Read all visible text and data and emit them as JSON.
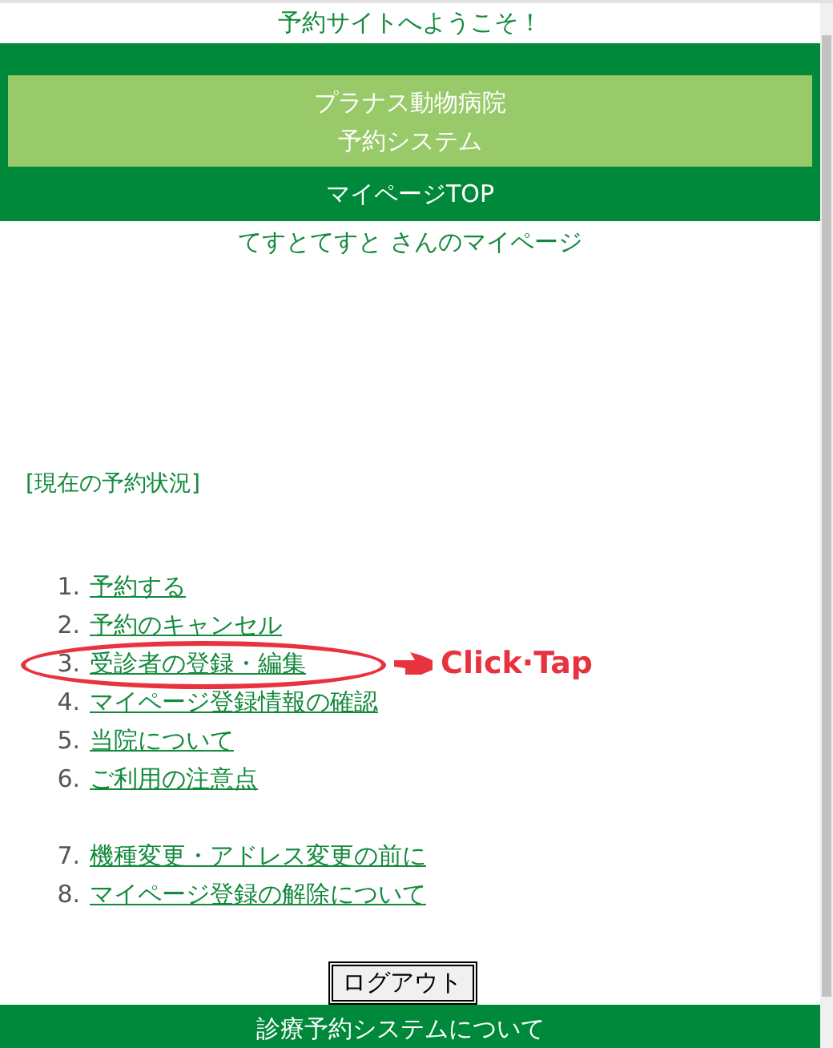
{
  "welcome": "予約サイトへようこそ！",
  "header": {
    "title_lines": [
      "プラナス動物病院",
      "予約システム"
    ],
    "nav": "マイページTOP"
  },
  "user_line": "てすとてすと さんのマイページ",
  "status_heading": "[現在の予約状況]",
  "menu_groups": [
    [
      {
        "number": "1.",
        "label": "予約する",
        "highlighted": false
      },
      {
        "number": "2.",
        "label": "予約のキャンセル",
        "highlighted": false
      },
      {
        "number": "3.",
        "label": "受診者の登録・編集",
        "highlighted": true
      },
      {
        "number": "4.",
        "label": "マイページ登録情報の確認",
        "highlighted": false
      },
      {
        "number": "5.",
        "label": "当院について",
        "highlighted": false
      },
      {
        "number": "6.",
        "label": "ご利用の注意点",
        "highlighted": false
      }
    ],
    [
      {
        "number": "7.",
        "label": "機種変更・アドレス変更の前に",
        "highlighted": false
      },
      {
        "number": "8.",
        "label": "マイページ登録の解除について",
        "highlighted": false
      }
    ]
  ],
  "annotation": "Click·Tap",
  "logout_button": "ログアウト",
  "footer": "診療予約システムについて"
}
